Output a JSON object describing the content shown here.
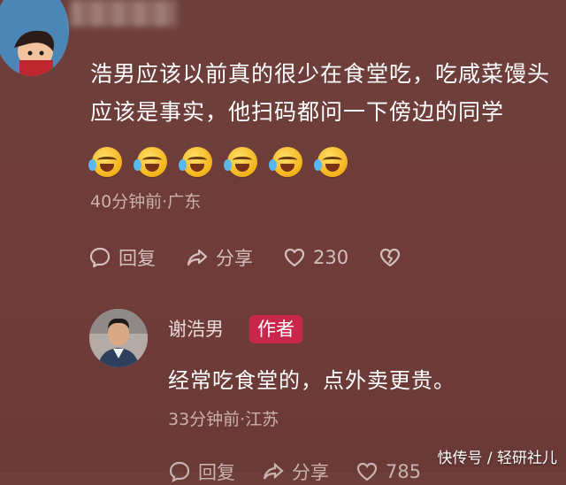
{
  "comment": {
    "text": "浩男应该以前真的很少在食堂吃，吃咸菜馒头应该是事实，他扫码都问一下傍边的同学",
    "emoji_icon": "laughing-crying-emoji",
    "emoji_count": 6,
    "meta": "40分钟前·广东",
    "actions": {
      "reply": "回复",
      "share": "分享",
      "likes": "230"
    }
  },
  "reply": {
    "author": "谢浩男",
    "badge": "作者",
    "text": "经常吃食堂的，点外卖更贵。",
    "meta": "33分钟前·江苏",
    "actions": {
      "reply": "回复",
      "share": "分享",
      "likes": "785"
    }
  },
  "watermark": "快传号 / 轻研社儿",
  "colors": {
    "background": "#6e3e3a",
    "badge": "#c8264a",
    "meta": "#cbb0ad"
  }
}
